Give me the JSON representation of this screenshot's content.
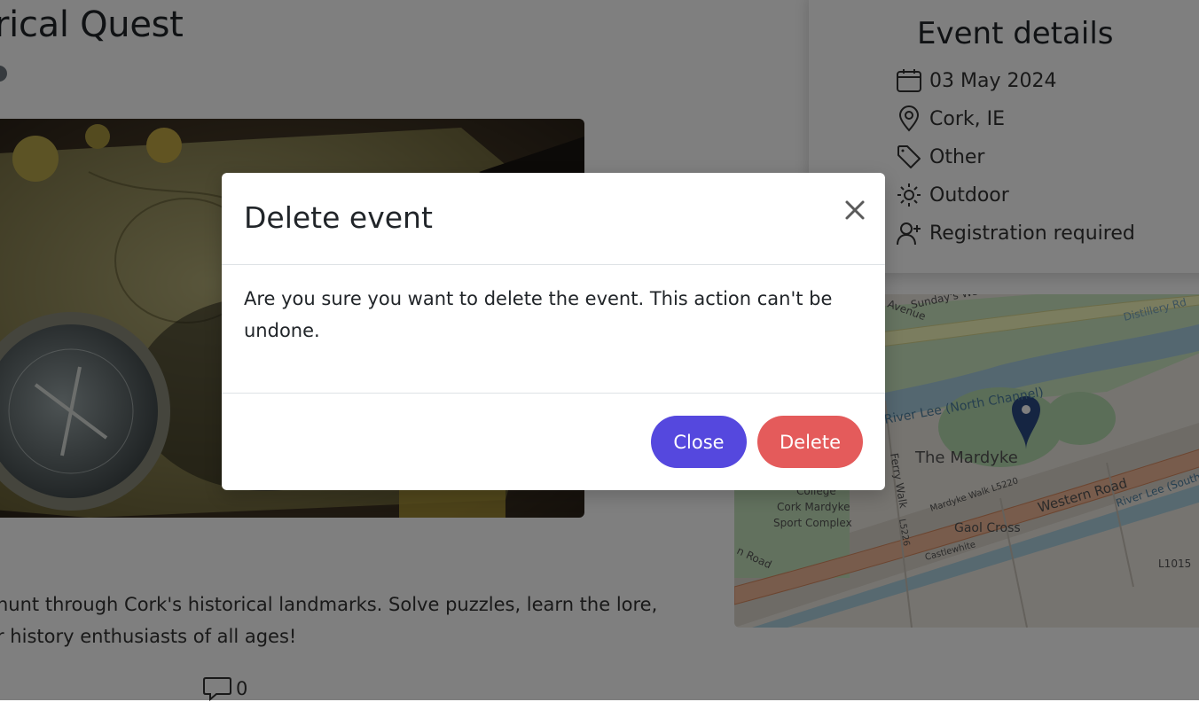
{
  "event": {
    "title": "rical Quest",
    "description_line1": "hunt through Cork's historical landmarks. Solve puzzles, learn the lore,",
    "description_line2": "r history enthusiasts of all ages!",
    "comment_count": "0"
  },
  "details": {
    "heading": "Event details",
    "date": "03 May 2024",
    "location": "Cork, IE",
    "category": "Other",
    "setting": "Outdoor",
    "registration": "Registration required"
  },
  "map": {
    "labels": {
      "sundays_well": "Sunday's Well Road",
      "distillery": "Distillery Rd",
      "avenue": "Avenue",
      "river_north": "River Lee (North Channel)",
      "mardyke": "The Mardyke",
      "ferry_walk": "Ferry Walk",
      "college": "College",
      "sport_complex_1": "Cork Mardyke",
      "sport_complex_2": "Sport Complex",
      "mardyke_walk": "Mardyke Walk L5220",
      "western_road": "Western Road",
      "river_south": "River Lee (South Ch)",
      "gaol_cross": "Gaol Cross",
      "castlewhite": "Castlewhite",
      "l5226": "L5226",
      "l1015": "L1015",
      "road": "n Road"
    }
  },
  "modal": {
    "title": "Delete event",
    "body": "Are you sure you want to delete the event. This action can't be undone.",
    "close_label": "Close",
    "delete_label": "Delete"
  },
  "colors": {
    "primary": "#5548de",
    "danger": "#e45b5b",
    "backdrop": "rgba(0,0,0,0.5)"
  }
}
